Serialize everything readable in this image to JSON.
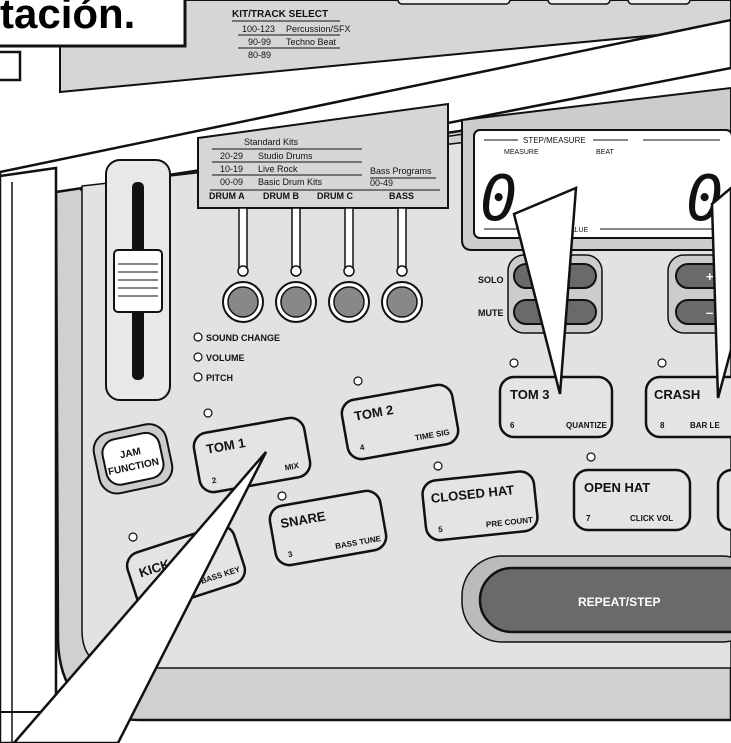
{
  "callout": {
    "title_fragment": "tación."
  },
  "kit_select": {
    "title": "KIT/TRACK SELECT",
    "top_rows": [
      {
        "range": "100-123",
        "name": "Percussion/SFX"
      },
      {
        "range": "90-99",
        "name": "Techno Beat"
      },
      {
        "range": "80-89",
        "name": ""
      }
    ],
    "rows": [
      {
        "range": "",
        "name": "Standard Kits"
      },
      {
        "range": "20-29",
        "name": "Studio Drums"
      },
      {
        "range": "10-19",
        "name": "Live Rock"
      },
      {
        "range": "00-09",
        "name": "Basic Drum Kits"
      }
    ],
    "bass_programs": {
      "label": "Bass Programs",
      "range": "00-49"
    },
    "tracks": [
      "DRUM A",
      "DRUM B",
      "DRUM C",
      "BASS"
    ]
  },
  "display": {
    "step_measure": "STEP/MEASURE",
    "measure": "MEASURE",
    "beat": "BEAT",
    "value_fragment": "ALUE",
    "digit_left": "0",
    "digit_right": "0"
  },
  "solo_mute": {
    "solo": "SOLO",
    "mute": "MUTE"
  },
  "plus_minus": {
    "plus": "+",
    "minus": "–"
  },
  "knob_modes": [
    "SOUND CHANGE",
    "VOLUME",
    "PITCH"
  ],
  "jam": {
    "line1": "JAM",
    "line2": "FUNCTION"
  },
  "pads": [
    {
      "name": "TOM 1",
      "num": "2",
      "func": "MIX"
    },
    {
      "name": "TOM 2",
      "num": "4",
      "func": "TIME SIG"
    },
    {
      "name": "TOM 3",
      "num": "6",
      "func": "QUANTIZE"
    },
    {
      "name": "CRASH",
      "num": "8",
      "func": "BAR LE"
    },
    {
      "name": "KICK",
      "num": "",
      "func": "BASS KEY"
    },
    {
      "name": "SNARE",
      "num": "3",
      "func": "BASS TUNE"
    },
    {
      "name": "CLOSED HAT",
      "num": "5",
      "func": "PRE COUNT"
    },
    {
      "name": "OPEN HAT",
      "num": "7",
      "func": "CLICK VOL"
    }
  ],
  "repeat_step": "REPEAT/STEP",
  "colors": {
    "panel": "#d2d2d2",
    "pad": "#e4e4e4",
    "dark_button": "#6a6a6a",
    "background": "#ffffff"
  }
}
